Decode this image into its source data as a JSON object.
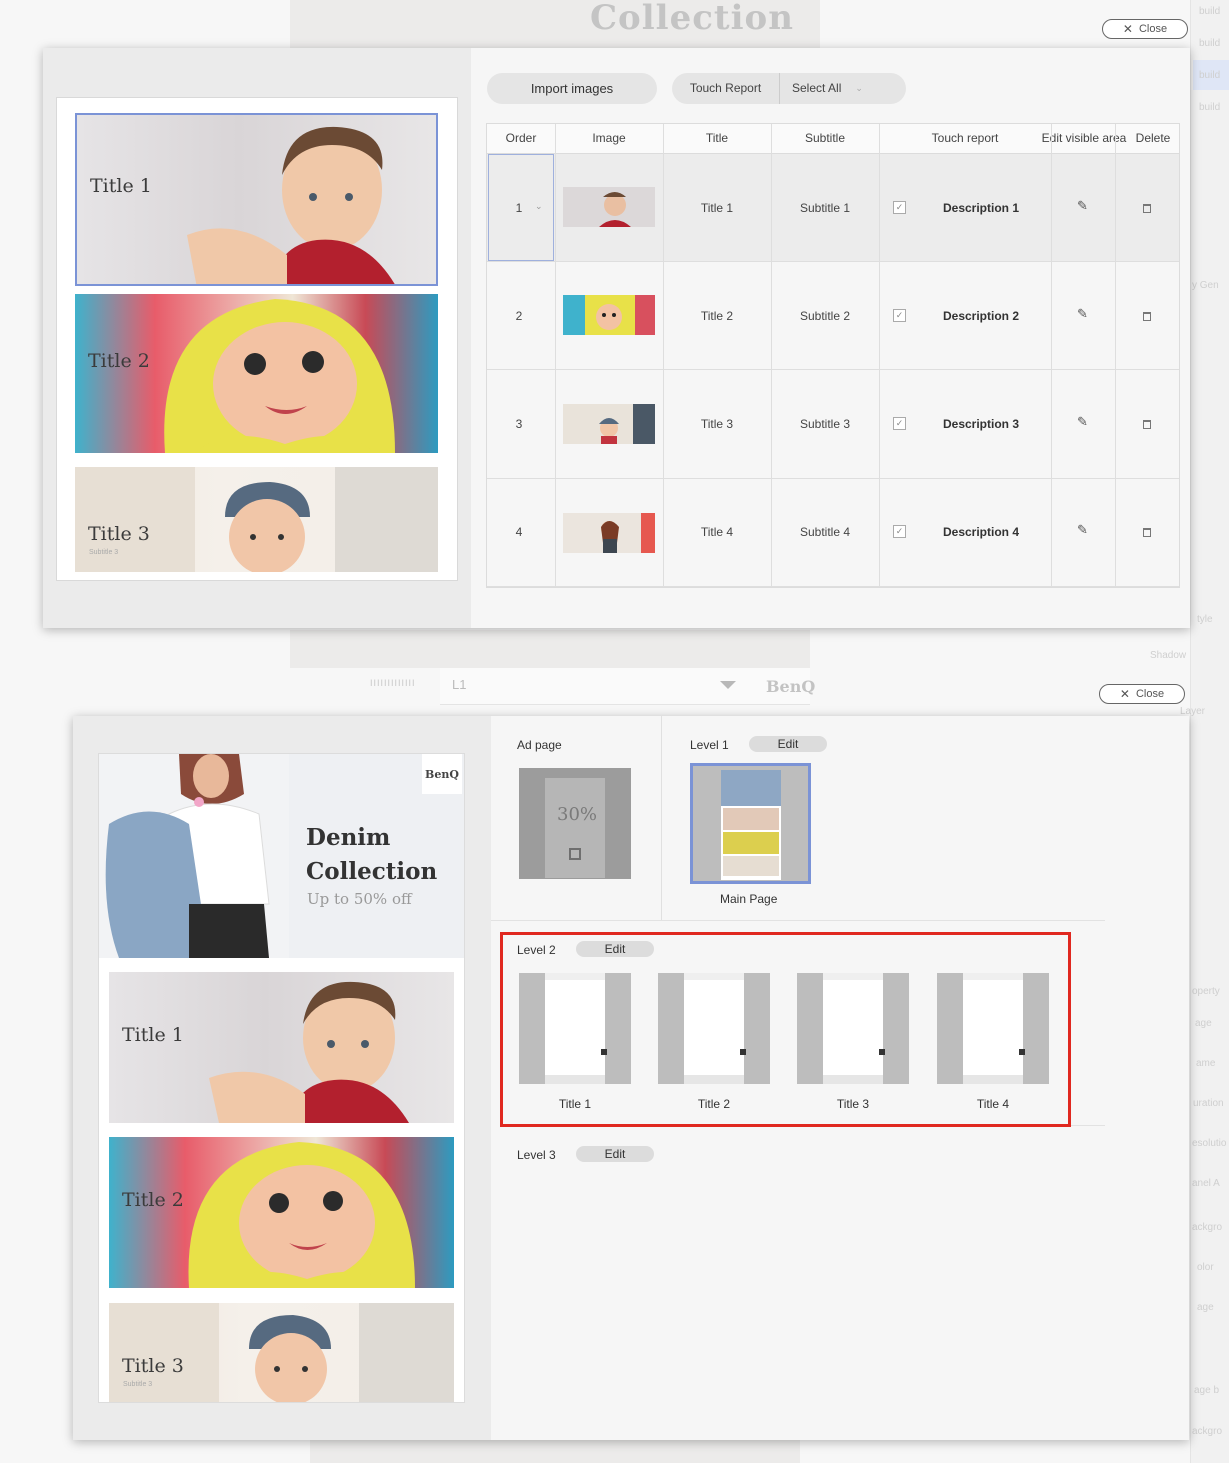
{
  "background": {
    "heading": "Collection",
    "right_labels": [
      "build",
      "build",
      "build",
      "build",
      "y Gen",
      "tyle",
      "Shadow",
      "Layer",
      "operty",
      "age",
      "ame",
      "uration",
      "esolutio",
      "anel A",
      "ackgro",
      "olor",
      "age",
      "age b",
      "ackgro"
    ],
    "dropdown_value": "L1",
    "brand": "BenQ"
  },
  "dialog1": {
    "close_label": "Close",
    "slides": [
      {
        "title": "Title 1",
        "subtitle": ""
      },
      {
        "title": "Title 2",
        "subtitle": ""
      },
      {
        "title": "Title 3",
        "subtitle": "Subtitle 3"
      }
    ],
    "toolbar": {
      "import_label": "Import images",
      "touch_report_label": "Touch Report",
      "select_all_label": "Select All"
    },
    "table": {
      "headers": [
        "Order",
        "Image",
        "Title",
        "Subtitle",
        "Touch report",
        "Edit visible area",
        "Delete"
      ],
      "rows": [
        {
          "order": "1",
          "title": "Title 1",
          "subtitle": "Subtitle 1",
          "touch": true,
          "description": "Description 1"
        },
        {
          "order": "2",
          "title": "Title 2",
          "subtitle": "Subtitle 2",
          "touch": true,
          "description": "Description 2"
        },
        {
          "order": "3",
          "title": "Title 3",
          "subtitle": "Subtitle 3",
          "touch": true,
          "description": "Description 3"
        },
        {
          "order": "4",
          "title": "Title 4",
          "subtitle": "Subtitle 4",
          "touch": true,
          "description": "Description 4"
        }
      ]
    }
  },
  "dialog2": {
    "close_label": "Close",
    "preview": {
      "brand": "BenQ",
      "headline_1": "Denim",
      "headline_2": "Collection",
      "subline": "Up to 50% off",
      "slides": [
        {
          "title": "Title 1",
          "subtitle": ""
        },
        {
          "title": "Title 2",
          "subtitle": ""
        },
        {
          "title": "Title 3",
          "subtitle": "Subtitle 3"
        }
      ]
    },
    "ad_page": {
      "label": "Ad page",
      "thumb_text": "30%"
    },
    "level1": {
      "label": "Level 1",
      "edit_label": "Edit",
      "page_caption": "Main Page"
    },
    "level2": {
      "label": "Level 2",
      "edit_label": "Edit",
      "pages": [
        "Title 1",
        "Title 2",
        "Title 3",
        "Title 4"
      ]
    },
    "level3": {
      "label": "Level 3",
      "edit_label": "Edit"
    }
  },
  "colors": {
    "highlight_red": "#e0281f",
    "selection_blue": "#7b93d6"
  }
}
